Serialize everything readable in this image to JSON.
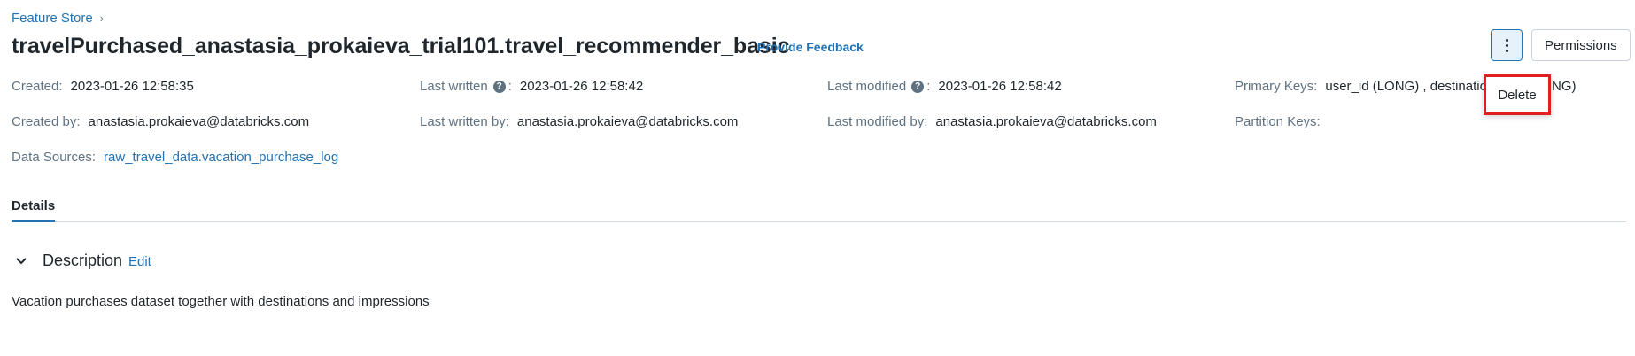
{
  "breadcrumb": {
    "label": "Feature Store"
  },
  "header": {
    "title": "travelPurchased_anastasia_prokaieva_trial101.travel_recommender_basic",
    "feedback_label": "Provide Feedback",
    "permissions_label": "Permissions"
  },
  "menu": {
    "delete_label": "Delete"
  },
  "meta": {
    "created": {
      "label": "Created:",
      "value": "2023-01-26 12:58:35"
    },
    "last_written": {
      "label": "Last written",
      "value": "2023-01-26 12:58:42"
    },
    "last_modified": {
      "label": "Last modified",
      "value": "2023-01-26 12:58:42"
    },
    "primary_keys": {
      "label": "Primary Keys:",
      "value_visible": "user_id (LONG) , destination",
      "value_tail": "NG)"
    },
    "created_by": {
      "label": "Created by:",
      "value": "anastasia.prokaieva@databricks.com"
    },
    "last_written_by": {
      "label": "Last written by:",
      "value": "anastasia.prokaieva@databricks.com"
    },
    "last_modified_by": {
      "label": "Last modified by:",
      "value": "anastasia.prokaieva@databricks.com"
    },
    "partition_keys": {
      "label": "Partition Keys:",
      "value": ""
    },
    "data_sources": {
      "label": "Data Sources:",
      "value": "raw_travel_data.vacation_purchase_log"
    }
  },
  "tabs": [
    {
      "label": "Details",
      "active": true
    }
  ],
  "description": {
    "heading": "Description",
    "edit_label": "Edit",
    "text": "Vacation purchases dataset together with destinations and impressions"
  },
  "colors": {
    "link": "#2272b4",
    "label_gray": "#5f7281",
    "highlight_red": "#e02020"
  },
  "icons": [
    "chevron-right-icon",
    "help-icon",
    "kebab-icon",
    "chevron-down-icon"
  ]
}
